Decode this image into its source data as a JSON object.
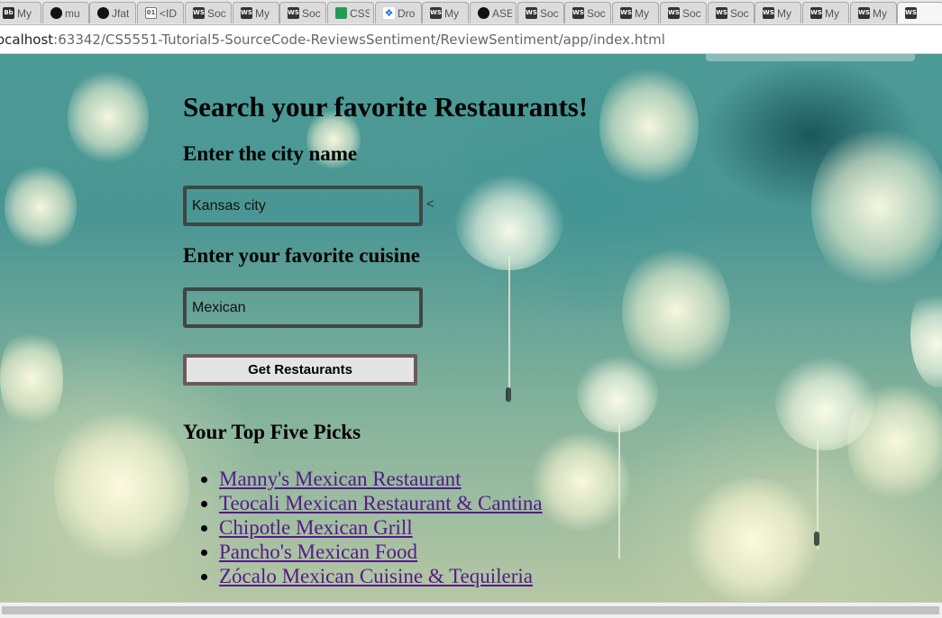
{
  "browser": {
    "tabs": [
      {
        "title": "My",
        "icon": "Bb"
      },
      {
        "title": "mu",
        "icon": "github"
      },
      {
        "title": "Jfat",
        "icon": "github"
      },
      {
        "title": "<ID",
        "icon": "doc"
      },
      {
        "title": "Soc",
        "icon": "WS"
      },
      {
        "title": "My",
        "icon": "WS"
      },
      {
        "title": "Soc",
        "icon": "WS"
      },
      {
        "title": "CSS",
        "icon": "sheet"
      },
      {
        "title": "Dro",
        "icon": "dropbox"
      },
      {
        "title": "My",
        "icon": "WS"
      },
      {
        "title": "ASE",
        "icon": "github"
      },
      {
        "title": "Soc",
        "icon": "WS"
      },
      {
        "title": "Soc",
        "icon": "WS"
      },
      {
        "title": "My",
        "icon": "WS"
      },
      {
        "title": "Soc",
        "icon": "WS"
      },
      {
        "title": "Soc",
        "icon": "WS"
      },
      {
        "title": "My",
        "icon": "WS"
      },
      {
        "title": "My",
        "icon": "WS"
      },
      {
        "title": "My",
        "icon": "WS"
      },
      {
        "title": "",
        "icon": "WS"
      }
    ],
    "address": {
      "host": "ocalhost",
      "path": ":63342/CS5551-Tutorial5-SourceCode-ReviewsSentiment/ReviewSentiment/app/index.html"
    }
  },
  "page": {
    "title": "Search your favorite Restaurants!",
    "city_label": "Enter the city name",
    "city_value": "Kansas city",
    "city_marker": "<",
    "cuisine_label": "Enter your favorite cuisine",
    "cuisine_value": "Mexican",
    "button_label": "Get Restaurants",
    "results_heading": "Your Top Five Picks",
    "results": [
      "Manny's Mexican Restaurant",
      "Teocali Mexican Restaurant & Cantina",
      "Chipotle Mexican Grill",
      "Pancho's Mexican Food",
      "Zócalo Mexican Cuisine & Tequileria"
    ]
  },
  "colors": {
    "link": "#551a8b",
    "input_border": "#3f4743",
    "button_border": "#6b5a5a",
    "background_teal": "#4a9694"
  }
}
